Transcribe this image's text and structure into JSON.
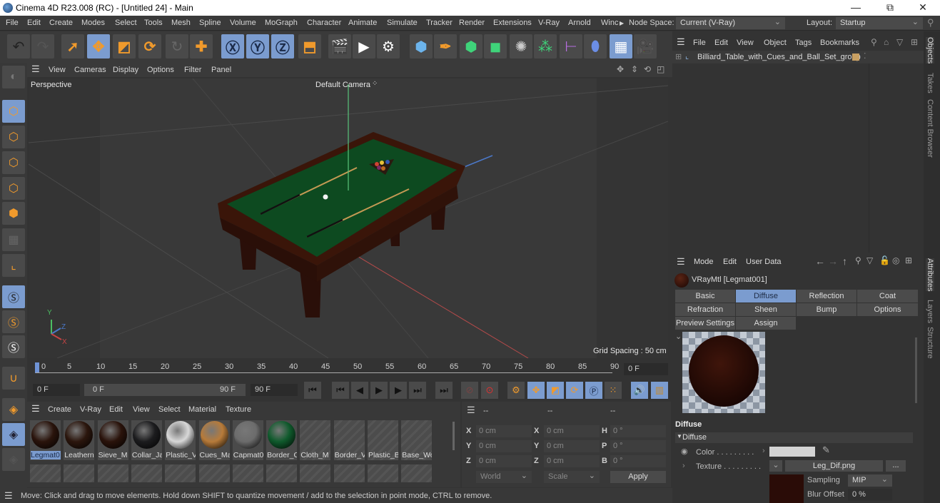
{
  "window": {
    "title": "Cinema 4D R23.008 (RC) - [Untitled 24] - Main",
    "min": "—",
    "max": "⧉",
    "close": "✕"
  },
  "menubar": {
    "items": [
      "File",
      "Edit",
      "Create",
      "Modes",
      "Select",
      "Tools",
      "Mesh",
      "Spline",
      "Volume",
      "MoGraph",
      "Character",
      "Animate",
      "Simulate",
      "Tracker",
      "Render",
      "Extensions",
      "V-Ray",
      "Arnold",
      "Winc"
    ],
    "node_space_label": "Node Space:",
    "node_space_value": "Current (V-Ray)",
    "layout_label": "Layout:",
    "layout_value": "Startup"
  },
  "viewport": {
    "menu": [
      "View",
      "Cameras",
      "Display",
      "Options",
      "Filter",
      "Panel"
    ],
    "view_name": "Perspective",
    "camera": "Default Camera",
    "grid_spacing": "Grid Spacing : 50 cm",
    "axes": {
      "x": "X",
      "y": "Y",
      "z": "Z"
    }
  },
  "timeline": {
    "ticks": [
      "0",
      "5",
      "10",
      "15",
      "20",
      "25",
      "30",
      "35",
      "40",
      "45",
      "50",
      "55",
      "60",
      "65",
      "70",
      "75",
      "80",
      "85",
      "90"
    ],
    "current_frame": "0 F",
    "start_frame": "0 F",
    "range_start": "0 F",
    "range_end": "90 F",
    "end_frame": "90 F"
  },
  "material_manager": {
    "menu": [
      "Create",
      "V-Ray",
      "Edit",
      "View",
      "Select",
      "Material",
      "Texture"
    ],
    "materials": [
      {
        "name": "Legmat0",
        "color": "#2a140c",
        "selected": true
      },
      {
        "name": "Leathern",
        "color": "#2b160d"
      },
      {
        "name": "Sieve_M",
        "color": "#2a130b"
      },
      {
        "name": "Collar_Ja",
        "color": "#1c1c1e"
      },
      {
        "name": "Plastic_V",
        "color": "#d8d8d8"
      },
      {
        "name": "Cues_Ma",
        "color": "#b77b3a"
      },
      {
        "name": "Capmat0",
        "color": "#6c6c6c"
      },
      {
        "name": "Border_C",
        "color": "#0f5a2c"
      },
      {
        "name": "Cloth_M",
        "color": null
      },
      {
        "name": "Border_V",
        "color": null
      },
      {
        "name": "Plastic_B",
        "color": null
      },
      {
        "name": "Base_Wo",
        "color": null
      }
    ]
  },
  "coordinates": {
    "headers": [
      "--",
      "--",
      "--"
    ],
    "rows": [
      {
        "l1": "X",
        "v1": "0 cm",
        "l2": "X",
        "v2": "0 cm",
        "l3": "H",
        "v3": "0 °"
      },
      {
        "l1": "Y",
        "v1": "0 cm",
        "l2": "Y",
        "v2": "0 cm",
        "l3": "P",
        "v3": "0 °"
      },
      {
        "l1": "Z",
        "v1": "0 cm",
        "l2": "Z",
        "v2": "0 cm",
        "l3": "B",
        "v3": "0 °"
      }
    ],
    "space": "World",
    "mode": "Scale",
    "apply": "Apply"
  },
  "status": "Move: Click and drag to move elements. Hold down SHIFT to quantize movement / add to the selection in point mode, CTRL to remove.",
  "objects": {
    "menu": [
      "File",
      "Edit",
      "View",
      "Object",
      "Tags",
      "Bookmarks"
    ],
    "items": [
      {
        "name": "Billiard_Table_with_Cues_and_Ball_Set_group"
      }
    ]
  },
  "attributes": {
    "menu": [
      "Mode",
      "Edit",
      "User Data"
    ],
    "material_title": "VRayMtl [Legmat001]",
    "tabs": [
      "Basic",
      "Diffuse",
      "Reflection",
      "Coat",
      "Refraction",
      "Sheen",
      "Bump",
      "Options",
      "Preview Settings",
      "Assign"
    ],
    "active_tab": "Diffuse",
    "section": "Diffuse",
    "group": "Diffuse",
    "color_label": "Color . . . . . . . . .",
    "texture_label": "Texture . . . . . . . . .",
    "texture_file": "Leg_Dif.png",
    "more": "...",
    "sampling_label": "Sampling",
    "sampling_value": "MIP",
    "blur_label": "Blur Offset",
    "blur_value": "0 %"
  },
  "side_tabs": [
    "Objects",
    "Takes",
    "Content Browser",
    "Attributes",
    "Layers",
    "Structure"
  ]
}
